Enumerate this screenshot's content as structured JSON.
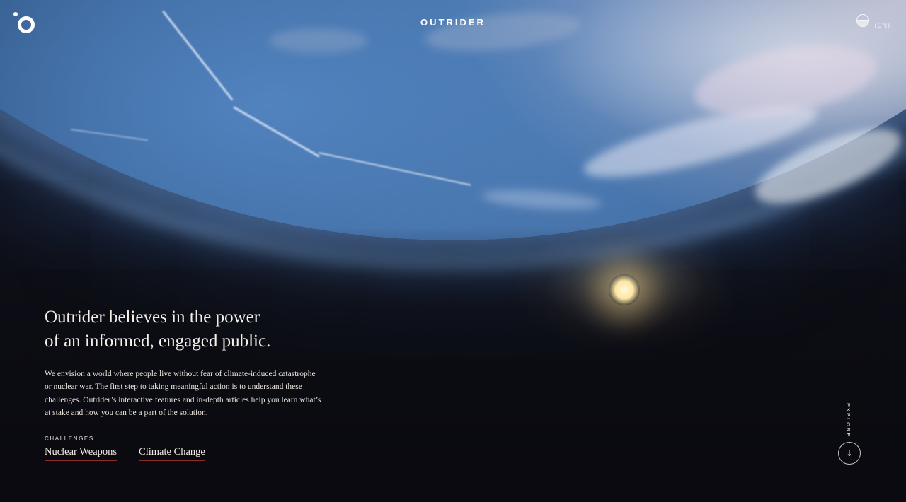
{
  "header": {
    "brand": "OUTRIDER",
    "logo_icon": "outrider-logo-icon",
    "language_icon": "globe-icon",
    "language_label": "(EN)"
  },
  "hero": {
    "headline_line1": "Outrider believes in the power",
    "headline_line2": "of an informed, engaged public.",
    "intro": "We envision a world where people live without fear of climate-induced catastrophe or nuclear war. The first step to taking meaningful action is to understand these challenges. Outrider’s interactive features and in-depth articles help you learn what’s at stake and how you can be a part of the solution.",
    "challenges_label": "CHALLENGES",
    "challenges": [
      {
        "label": "Nuclear Weapons"
      },
      {
        "label": "Climate Change"
      }
    ]
  },
  "explore": {
    "label": "EXPLORE",
    "icon": "arrow-down-icon",
    "arrow_glyph": "↓"
  },
  "colors": {
    "link_underline": "#8c2f2a",
    "background": "#0c0d13",
    "text": "#f1ece4"
  }
}
